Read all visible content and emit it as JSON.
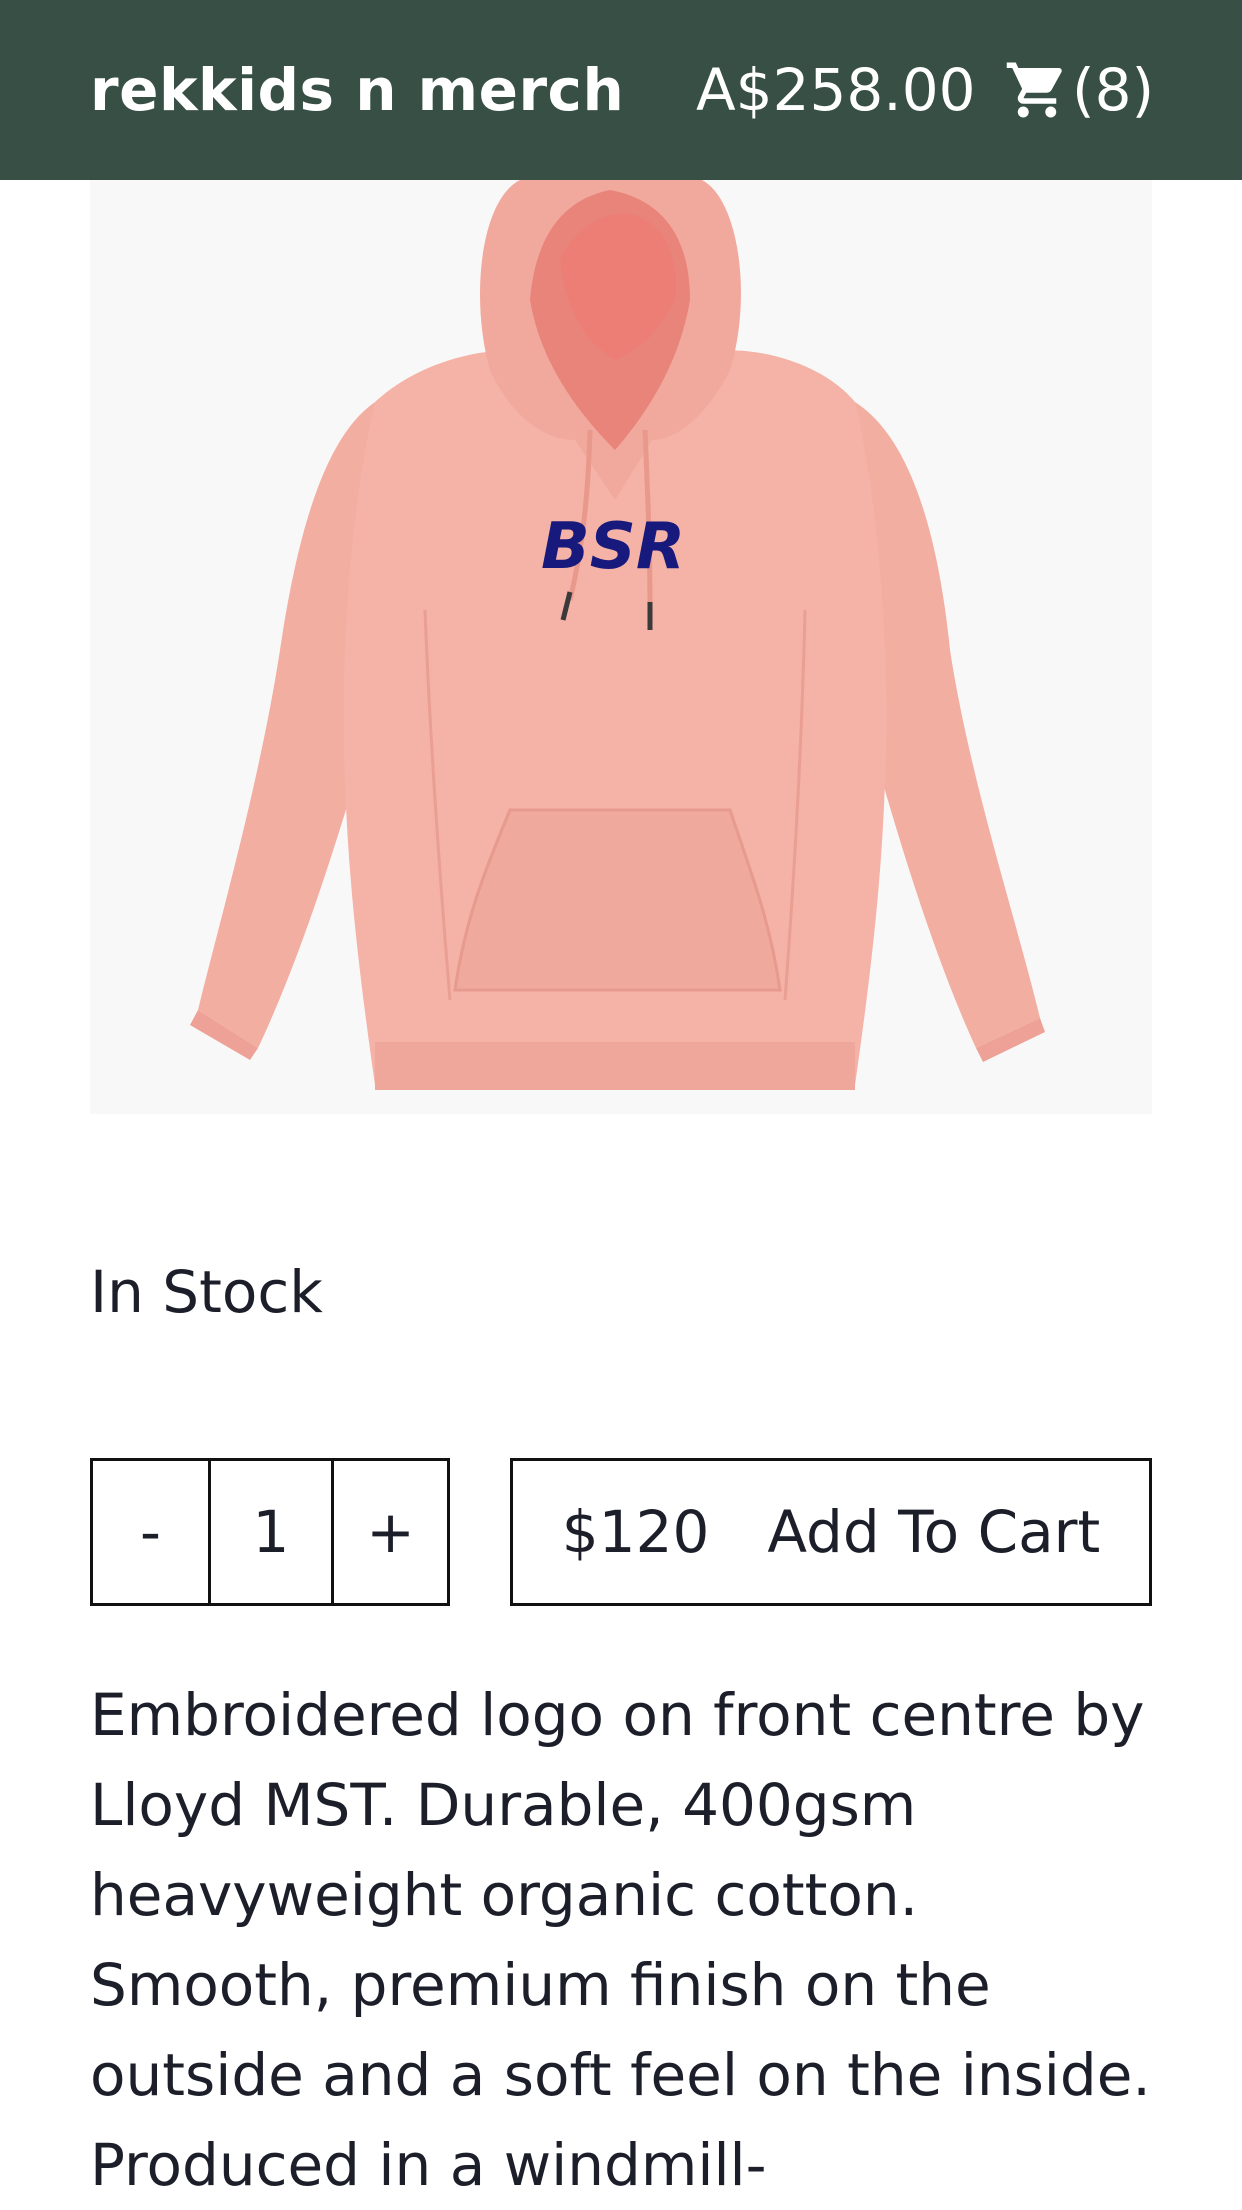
{
  "header": {
    "brand": "rekkids n merch",
    "cart_total": "A$258.00",
    "cart_count": "(8)",
    "background_color": "#374f45",
    "cart_icon": "shopping-cart-icon"
  },
  "product": {
    "image_alt": "Pink hoodie with embroidered BSR logo",
    "logo_text": "BSR",
    "stock_status": "In Stock",
    "quantity": {
      "minus_label": "-",
      "value": "1",
      "plus_label": "+"
    },
    "price": "$120",
    "add_to_cart_label": "Add To Cart",
    "description": "Embroidered logo on front centre by Lloyd MST. Durable, 400gsm heavyweight organic cotton. Smooth, premium finish on the outside and a soft feel on the inside. Produced in a windmill-"
  }
}
